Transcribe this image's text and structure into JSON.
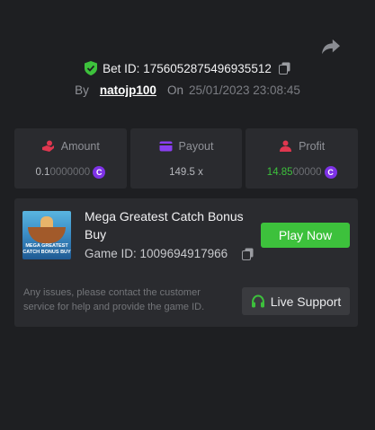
{
  "bet": {
    "id_label": "Bet ID:",
    "id_value": "1756052875496935512",
    "by_label": "By",
    "username": "natojp100",
    "on_label": "On",
    "datetime": "25/01/2023 23:08:45"
  },
  "stats": {
    "amount": {
      "label": "Amount",
      "value_main": "0.1",
      "value_dim": "0000000",
      "currency_symbol": "C"
    },
    "payout": {
      "label": "Payout",
      "value": "149.5 x"
    },
    "profit": {
      "label": "Profit",
      "value_main": "14.85",
      "value_dim": "00000",
      "currency_symbol": "C"
    }
  },
  "game": {
    "title": "Mega Greatest Catch Bonus Buy",
    "id_label": "Game ID:",
    "id_value": "1009694917966",
    "thumb_line1": "MEGA GREATEST",
    "thumb_line2": "CATCH BONUS BUY",
    "play_label": "Play Now"
  },
  "support": {
    "issue_text": "Any issues, please contact the customer service for help and provide the game ID.",
    "button_label": "Live Support"
  },
  "colors": {
    "background": "#1e1f22",
    "panel": "#2a2b2f",
    "accent_green": "#3dc13c",
    "coin_purple": "#7e32e6",
    "amount_icon": "#e0374f",
    "payout_icon": "#8a3ff0",
    "profit_icon": "#e0374f"
  },
  "icons": {
    "share": "share-arrow-icon",
    "verified": "shield-check-icon",
    "copy": "copy-icon",
    "amount": "hand-coin-icon",
    "payout": "wallet-icon",
    "profit": "profit-icon",
    "support": "headset-icon"
  }
}
